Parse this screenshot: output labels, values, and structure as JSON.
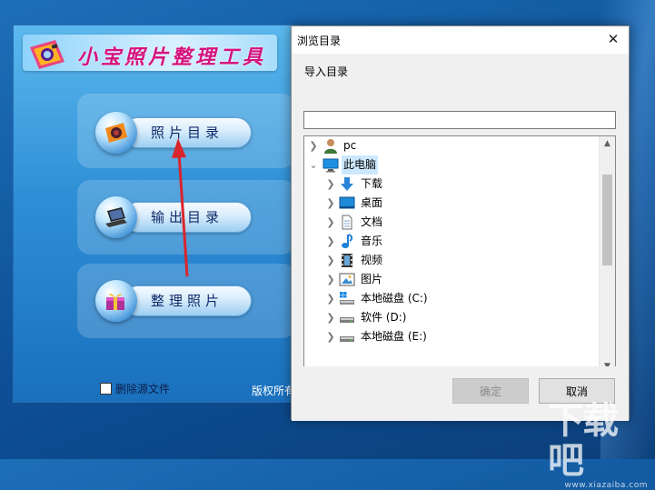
{
  "app": {
    "title": "小宝照片整理工具",
    "menu": [
      {
        "id": "photo-dir",
        "label": "照片目录",
        "icon": "camera-icon"
      },
      {
        "id": "output-dir",
        "label": "输出目录",
        "icon": "laptop-icon"
      },
      {
        "id": "organize",
        "label": "整理照片",
        "icon": "gift-box-icon"
      }
    ],
    "delete_source_label": "删除源文件",
    "delete_source_checked": false,
    "copyright_text": "版权所有"
  },
  "dialog": {
    "title": "浏览目录",
    "close_glyph": "✕",
    "prompt": "导入目录",
    "path_value": "",
    "tree": [
      {
        "label": "pc",
        "icon": "user-icon",
        "level": 0,
        "expanded": false,
        "selected": false
      },
      {
        "label": "此电脑",
        "icon": "computer-icon",
        "level": 0,
        "expanded": true,
        "selected": true
      },
      {
        "label": "下载",
        "icon": "download-arrow-icon",
        "level": 1,
        "expanded": false,
        "selected": false
      },
      {
        "label": "桌面",
        "icon": "desktop-icon",
        "level": 1,
        "expanded": false,
        "selected": false
      },
      {
        "label": "文档",
        "icon": "document-icon",
        "level": 1,
        "expanded": false,
        "selected": false
      },
      {
        "label": "音乐",
        "icon": "music-note-icon",
        "level": 1,
        "expanded": false,
        "selected": false
      },
      {
        "label": "视频",
        "icon": "film-icon",
        "level": 1,
        "expanded": false,
        "selected": false
      },
      {
        "label": "图片",
        "icon": "picture-icon",
        "level": 1,
        "expanded": false,
        "selected": false
      },
      {
        "label": "本地磁盘 (C:)",
        "icon": "windows-drive-icon",
        "level": 1,
        "expanded": false,
        "selected": false
      },
      {
        "label": "软件 (D:)",
        "icon": "drive-icon",
        "level": 1,
        "expanded": false,
        "selected": false
      },
      {
        "label": "本地磁盘 (E:)",
        "icon": "drive-icon",
        "level": 1,
        "expanded": false,
        "selected": false
      }
    ],
    "ok_label": "确定",
    "ok_enabled": false,
    "cancel_label": "取消"
  },
  "colors": {
    "selection": "#cce8ff",
    "app_title": "#d6127d",
    "menu_text": "#102a6a"
  }
}
